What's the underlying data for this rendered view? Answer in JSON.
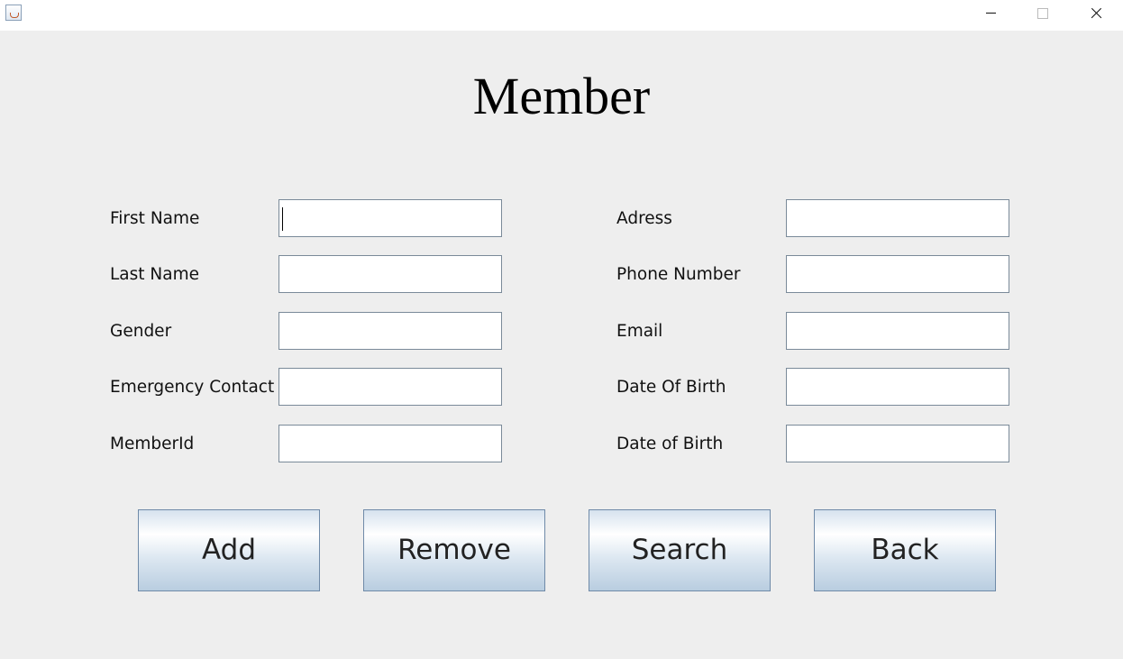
{
  "window": {
    "icon": "java-cup-icon",
    "controls": [
      "minimize-icon",
      "maximize-icon",
      "close-icon"
    ]
  },
  "title": "Member",
  "form": {
    "left": [
      {
        "label": "First Name",
        "value": ""
      },
      {
        "label": "Last Name",
        "value": ""
      },
      {
        "label": "Gender",
        "value": ""
      },
      {
        "label": "Emergency Contact",
        "value": ""
      },
      {
        "label": "MemberId",
        "value": ""
      }
    ],
    "right": [
      {
        "label": "Adress",
        "value": ""
      },
      {
        "label": "Phone Number",
        "value": ""
      },
      {
        "label": "Email",
        "value": ""
      },
      {
        "label": "Date Of Birth",
        "value": ""
      },
      {
        "label": "Date of Birth",
        "value": ""
      }
    ]
  },
  "buttons": {
    "add": "Add",
    "remove": "Remove",
    "search": "Search",
    "back": "Back"
  }
}
